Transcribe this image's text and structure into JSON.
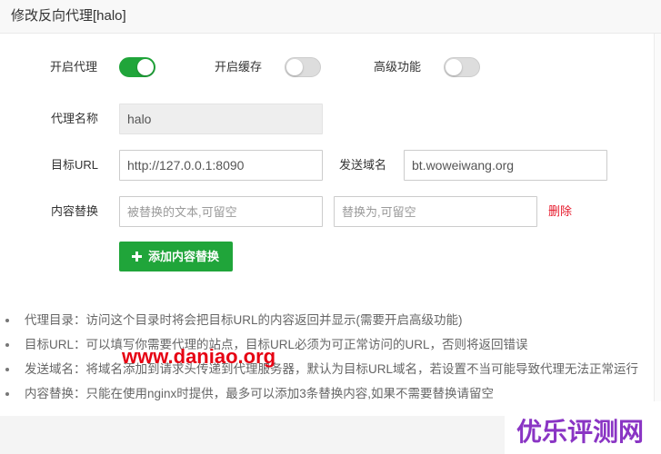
{
  "dialog": {
    "title": "修改反向代理[halo]"
  },
  "toggles": [
    {
      "label": "开启代理",
      "on": true
    },
    {
      "label": "开启缓存",
      "on": false
    },
    {
      "label": "高级功能",
      "on": false
    }
  ],
  "proxy_name": {
    "label": "代理名称",
    "value": "halo"
  },
  "target_url": {
    "label": "目标URL",
    "value": "http://127.0.0.1:8090"
  },
  "send_domain": {
    "label": "发送域名",
    "value": "bt.woweiwang.org"
  },
  "content_replace": {
    "label": "内容替换",
    "from_placeholder": "被替换的文本,可留空",
    "to_placeholder": "替换为,可留空",
    "delete_label": "删除"
  },
  "add_button": {
    "label": "添加内容替换",
    "icon": "plus-icon"
  },
  "help": [
    "代理目录：访问这个目录时将会把目标URL的内容返回并显示(需要开启高级功能)",
    "目标URL：可以填写你需要代理的站点，目标URL必须为可正常访问的URL，否则将返回错误",
    "发送域名：将域名添加到请求头传递到代理服务器，默认为目标URL域名，若设置不当可能导致代理无法正常运行",
    "内容替换：只能在使用nginx时提供，最多可以添加3条替换内容,如果不需要替换请留空"
  ],
  "watermark": {
    "site": "www.daniao.org",
    "brand": "优乐评测网"
  },
  "colors": {
    "accent": "#20a53a",
    "danger": "#e6192b",
    "watermark_red": "#e60012",
    "watermark_purple": "#8a35c4"
  }
}
